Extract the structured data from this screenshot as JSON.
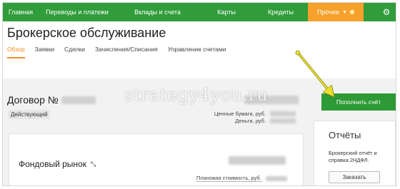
{
  "nav": {
    "items": [
      "Главная",
      "Переводы и платежи",
      "Вклады и счета",
      "Карты",
      "Кредиты"
    ],
    "special": "Прочее",
    "special_chevron": "▼"
  },
  "page": {
    "title": "Брокерское обслуживание",
    "tabs": [
      "Обзор",
      "Заявки",
      "Сделки",
      "Зачисления/Списания",
      "Управление счетами"
    ],
    "active_tab": "Обзор"
  },
  "contract": {
    "label": "Договор №",
    "status": "Действующий",
    "securities_label": "Ценные бумаги, руб.",
    "money_label": "Деньги, руб."
  },
  "actions": {
    "topup": "Пополнить счёт"
  },
  "stock_market": {
    "title": "Фондовый рынок",
    "planned_value_label": "Плановая стоимость, руб."
  },
  "reports": {
    "title": "Отчёты",
    "description": "Брокерский отчёт и справка 2НДФЛ.",
    "order_button": "Заказать"
  },
  "watermark": "strategy4you.ru",
  "colors": {
    "nav_green": "#309c3a",
    "nav_orange": "#f5a12b",
    "button_green": "#2d9a35",
    "tab_active": "#f08c1e",
    "arrow": "#e8e02a"
  }
}
